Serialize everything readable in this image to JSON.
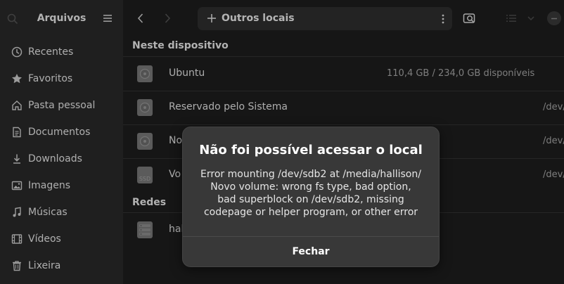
{
  "sidebar": {
    "title": "Arquivos",
    "items": [
      {
        "label": "Recentes",
        "icon": "clock-icon"
      },
      {
        "label": "Favoritos",
        "icon": "star-icon"
      },
      {
        "label": "Pasta pessoal",
        "icon": "home-icon"
      },
      {
        "label": "Documentos",
        "icon": "document-icon"
      },
      {
        "label": "Downloads",
        "icon": "download-icon"
      },
      {
        "label": "Imagens",
        "icon": "image-icon"
      },
      {
        "label": "Músicas",
        "icon": "music-icon"
      },
      {
        "label": "Vídeos",
        "icon": "video-icon"
      },
      {
        "label": "Lixeira",
        "icon": "trash-icon"
      }
    ]
  },
  "header": {
    "path_label": "Outros locais"
  },
  "sections": {
    "device": "Neste dispositivo",
    "networks": "Redes"
  },
  "devices": [
    {
      "name": "Ubuntu",
      "info": "110,4 GB / 234,0 GB disponíveis",
      "icon": "drive-icon"
    },
    {
      "name": "Reservado pelo Sistema",
      "info": "/dev/",
      "icon": "drive-icon"
    },
    {
      "name": "No",
      "info": "/dev/",
      "icon": "drive-icon"
    },
    {
      "name": "Vo",
      "info": "/dev/",
      "icon": "ssd-icon"
    }
  ],
  "networks": [
    {
      "name": "hal",
      "icon": "network-server-icon"
    }
  ],
  "dialog": {
    "title": "Não foi possível acessar o local",
    "message": "Error mounting /dev/sdb2 at /media/hallison/ Novo volume: wrong fs type, bad option, bad superblock on /dev/sdb2, missing codepage or helper program, or other error",
    "button": "Fechar"
  },
  "colors": {
    "sidebar_bg": "#2a2a2a",
    "main_bg": "#1e1e1e",
    "dialog_bg": "#383838"
  }
}
